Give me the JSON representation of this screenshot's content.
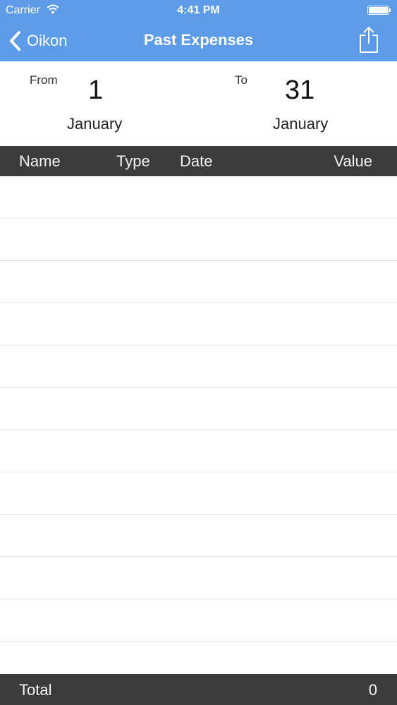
{
  "status_bar": {
    "carrier": "Carrier",
    "time": "4:41 PM",
    "wifi_icon": "wifi-icon",
    "battery_icon": "battery-icon"
  },
  "nav": {
    "back_label": "Oikon",
    "title": "Past Expenses",
    "share_icon": "share-icon",
    "bar_color": "#5b9be8"
  },
  "date_range": {
    "from_label": "From",
    "from_day": "1",
    "from_month": "January",
    "to_label": "To",
    "to_day": "31",
    "to_month": "January"
  },
  "table": {
    "columns": [
      "Name",
      "Type",
      "Date",
      "Value"
    ],
    "rows": [],
    "header_color": "#3b3b3b"
  },
  "footer": {
    "total_label": "Total",
    "total_value": "0"
  }
}
